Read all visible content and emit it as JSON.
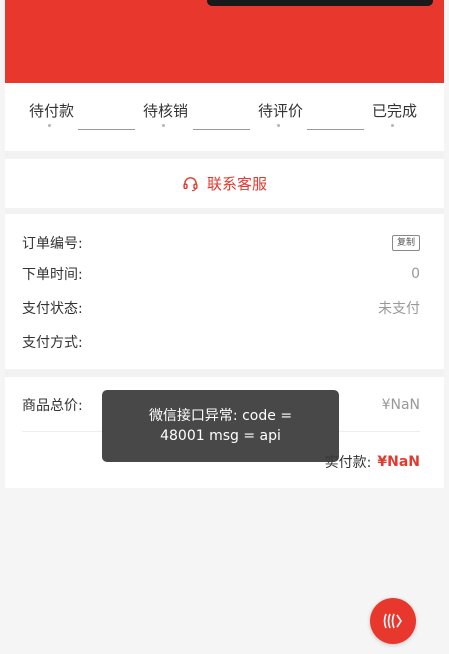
{
  "colors": {
    "accent": "#e8382d",
    "text_muted": "#999999"
  },
  "steps": [
    {
      "label": "待付款"
    },
    {
      "label": "待核销"
    },
    {
      "label": "待评价"
    },
    {
      "label": "已完成"
    }
  ],
  "service": {
    "label": "联系客服",
    "icon": "headset-icon"
  },
  "order": {
    "number_label": "订单编号:",
    "copy_label": "复制",
    "time_label": "下单时间:",
    "time_value": "0",
    "status_label": "支付状态:",
    "status_value": "未支付",
    "method_label": "支付方式:"
  },
  "summary": {
    "total_label": "商品总价:",
    "total_value": "¥NaN",
    "paid_label": "实付款:",
    "paid_value": "¥NaN"
  },
  "toast": {
    "message": "微信接口异常: code = 48001 msg = api"
  },
  "fab": {
    "icon": "wave-icon"
  }
}
